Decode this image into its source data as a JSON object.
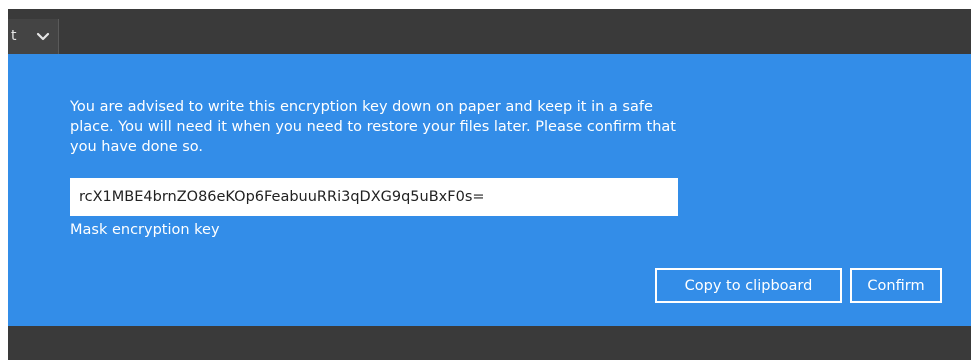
{
  "background": {
    "dropdown_text": "t",
    "chevron_icon": "chevron-down-icon"
  },
  "dialog": {
    "message": "You are advised to write this encryption key down on paper and keep it in a safe place. You will need it when you need to restore your files later. Please confirm that you have done so.",
    "encryption_key": "rcX1MBE4brnZO86eKOp6FeabuuRRi3qDXG9q5uBxF0s=",
    "mask_link_label": "Mask encryption key",
    "copy_button_label": "Copy to clipboard",
    "confirm_button_label": "Confirm"
  },
  "colors": {
    "dialog_blue": "#338de8",
    "backdrop": "#3a3a3a",
    "text": "#ffffff"
  }
}
